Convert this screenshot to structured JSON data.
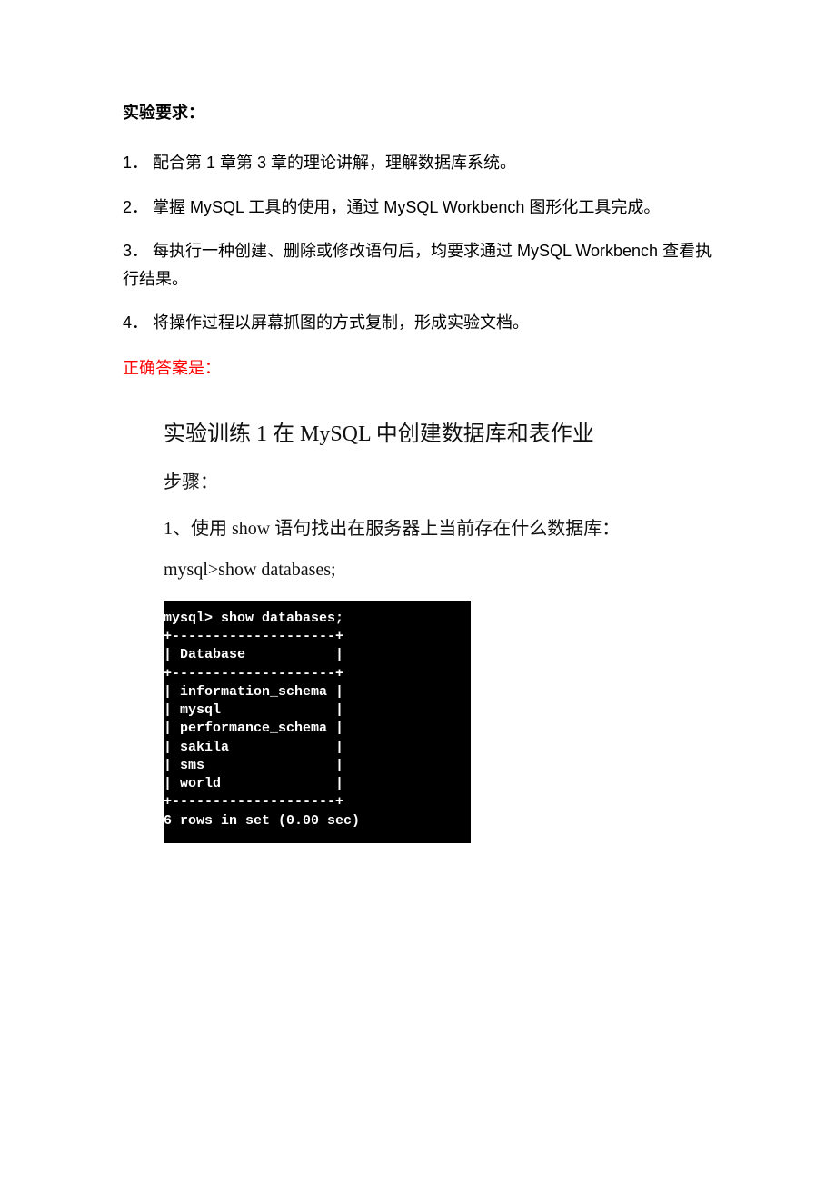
{
  "heading": "实验要求：",
  "requirements": [
    "1． 配合第 1 章第 3 章的理论讲解，理解数据库系统。",
    "2． 掌握 MySQL 工具的使用，通过 MySQL Workbench 图形化工具完成。",
    "3． 每执行一种创建、删除或修改语句后，均要求通过 MySQL Workbench 查看执行结果。",
    "4． 将操作过程以屏幕抓图的方式复制，形成实验文档。"
  ],
  "answer_label": "正确答案是：",
  "inner": {
    "title": "实验训练 1  在 MySQL 中创建数据库和表作业",
    "steps_label": "步骤：",
    "step1": "1、使用 show 语句找出在服务器上当前存在什么数据库：",
    "command": "mysql>show  databases;"
  },
  "terminal": {
    "prompt": "mysql> show databases;",
    "border_top": "+--------------------+",
    "header": "| Database           |",
    "border_mid": "+--------------------+",
    "rows": [
      "| information_schema |",
      "| mysql              |",
      "| performance_schema |",
      "| sakila             |",
      "| sms                |",
      "| world              |"
    ],
    "border_bot": "+--------------------+",
    "footer": "6 rows in set (0.00 sec)"
  }
}
